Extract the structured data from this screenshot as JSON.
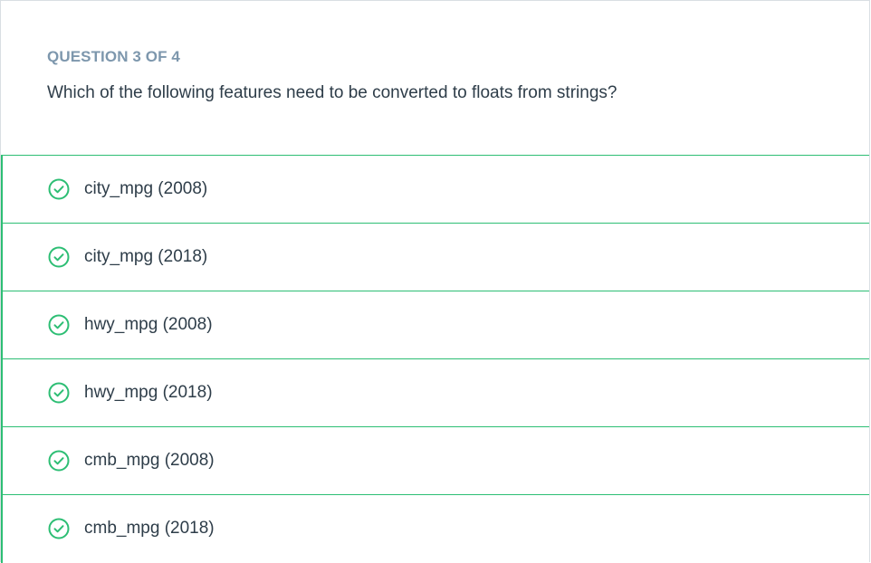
{
  "question": {
    "counter": "QUESTION 3 OF 4",
    "text": "Which of the following features need to be converted to floats from strings?"
  },
  "options": [
    {
      "label": "city_mpg (2008)",
      "selected": true
    },
    {
      "label": "city_mpg (2018)",
      "selected": true
    },
    {
      "label": "hwy_mpg (2008)",
      "selected": true
    },
    {
      "label": "hwy_mpg (2018)",
      "selected": true
    },
    {
      "label": "cmb_mpg (2008)",
      "selected": true
    },
    {
      "label": "cmb_mpg (2018)",
      "selected": true
    }
  ],
  "colors": {
    "accent_green": "#2dbe74",
    "counter_text": "#7d97ad",
    "body_text": "#2e3d49"
  },
  "icons": {
    "option_marker": "check-circle-icon"
  }
}
